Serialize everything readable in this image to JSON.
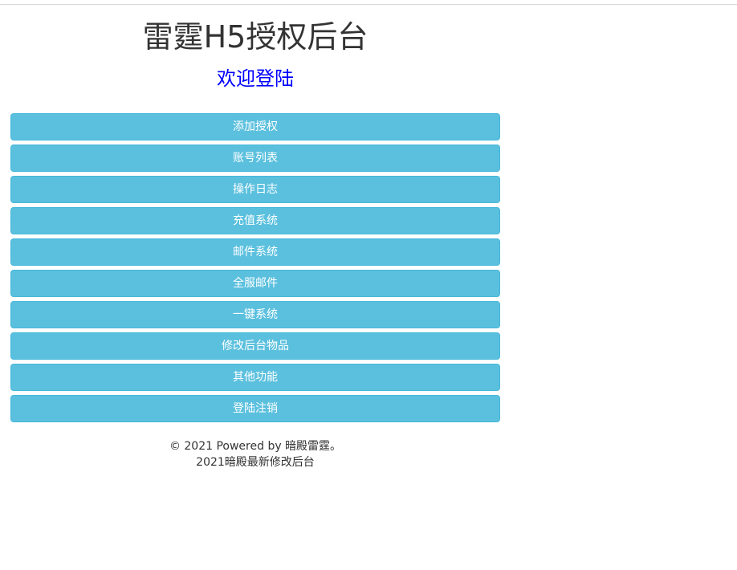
{
  "header": {
    "title": "雷霆H5授权后台",
    "welcome": "欢迎登陆"
  },
  "menu": {
    "items": [
      {
        "label": "添加授权"
      },
      {
        "label": "账号列表"
      },
      {
        "label": "操作日志"
      },
      {
        "label": "充值系统"
      },
      {
        "label": "邮件系统"
      },
      {
        "label": "全服邮件"
      },
      {
        "label": "一键系统"
      },
      {
        "label": "修改后台物品"
      },
      {
        "label": "其他功能"
      },
      {
        "label": "登陆注销"
      }
    ]
  },
  "footer": {
    "copyright": "© 2021 Powered by 暗殿雷霆。",
    "subtitle": "2021暗殿最新修改后台"
  },
  "colors": {
    "button_bg": "#5bc0de",
    "button_border": "#46b8da",
    "welcome_text": "#0000ff",
    "title_text": "#333333"
  }
}
